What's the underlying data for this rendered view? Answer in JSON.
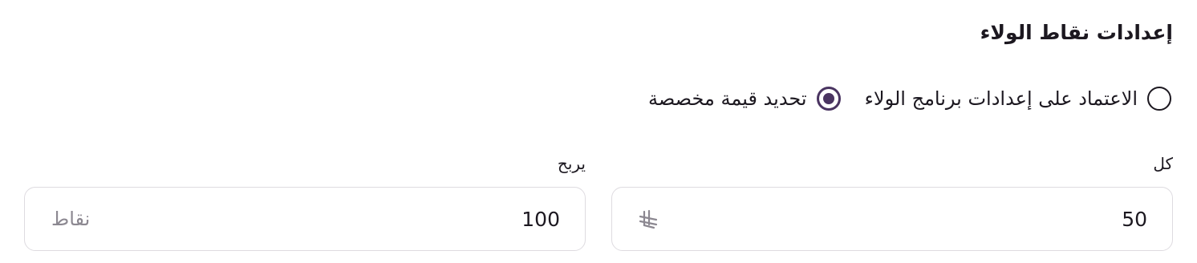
{
  "section": {
    "title": "إعدادات نقاط الولاء"
  },
  "radio": {
    "options": [
      {
        "label": "الاعتماد على إعدادات برنامج الولاء",
        "checked": false
      },
      {
        "label": "تحديد قيمة مخصصة",
        "checked": true
      }
    ]
  },
  "fields": {
    "every": {
      "label": "كل",
      "value": "50",
      "suffix_icon": "riyal-currency-icon"
    },
    "earn": {
      "label": "يربح",
      "value": "100",
      "suffix": "نقاط"
    }
  },
  "colors": {
    "accent": "#4a3461",
    "border": "#dedbe0",
    "muted": "#8c8891",
    "text": "#1c1820"
  }
}
